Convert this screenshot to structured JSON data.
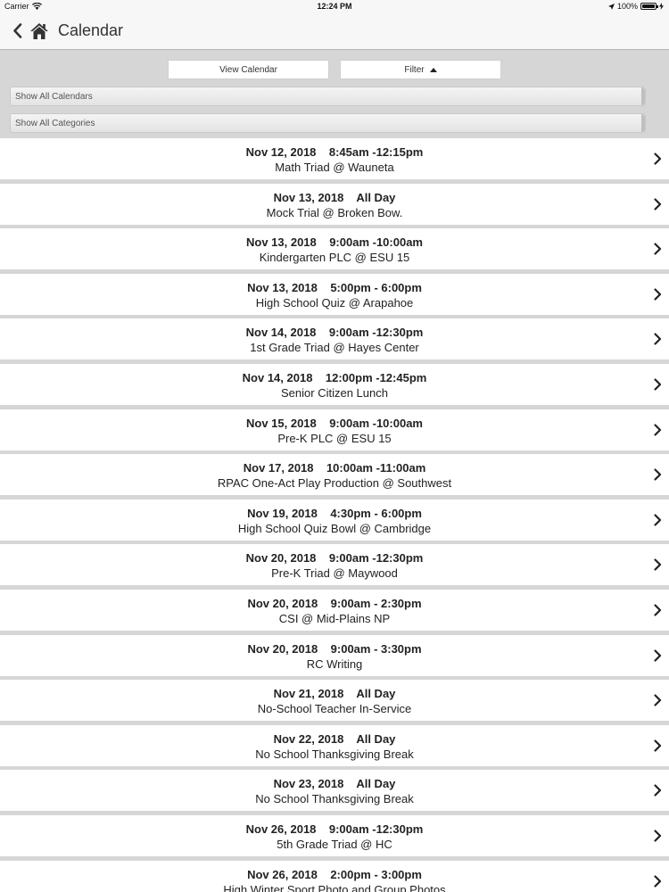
{
  "status_bar": {
    "carrier": "Carrier",
    "time": "12:24 PM",
    "battery": "100%",
    "battery_level": 1.0
  },
  "nav": {
    "title": "Calendar"
  },
  "toolbar": {
    "view_calendar_label": "View Calendar",
    "filter_label": "Filter"
  },
  "dropdowns": {
    "calendars": "Show All Calendars",
    "categories": "Show All Categories"
  },
  "events": [
    {
      "when": "Nov 12, 2018    8:45am -12:15pm",
      "title": "Math Triad @ Wauneta"
    },
    {
      "when": "Nov 13, 2018    All Day",
      "title": "Mock Trial @ Broken Bow."
    },
    {
      "when": "Nov 13, 2018    9:00am -10:00am",
      "title": "Kindergarten PLC @ ESU 15"
    },
    {
      "when": "Nov 13, 2018    5:00pm - 6:00pm",
      "title": "High School Quiz @ Arapahoe"
    },
    {
      "when": "Nov 14, 2018    9:00am -12:30pm",
      "title": "1st Grade Triad @ Hayes Center"
    },
    {
      "when": "Nov 14, 2018    12:00pm -12:45pm",
      "title": "Senior Citizen Lunch"
    },
    {
      "when": "Nov 15, 2018    9:00am -10:00am",
      "title": "Pre-K PLC @ ESU 15"
    },
    {
      "when": "Nov 17, 2018    10:00am -11:00am",
      "title": "RPAC One-Act Play Production @ Southwest"
    },
    {
      "when": "Nov 19, 2018    4:30pm - 6:00pm",
      "title": "High School Quiz Bowl @ Cambridge"
    },
    {
      "when": "Nov 20, 2018    9:00am -12:30pm",
      "title": "Pre-K Triad @ Maywood"
    },
    {
      "when": "Nov 20, 2018    9:00am - 2:30pm",
      "title": "CSI @ Mid-Plains NP"
    },
    {
      "when": "Nov 20, 2018    9:00am - 3:30pm",
      "title": "RC Writing"
    },
    {
      "when": "Nov 21, 2018    All Day",
      "title": "No-School Teacher In-Service"
    },
    {
      "when": "Nov 22, 2018    All Day",
      "title": "No School Thanksgiving Break"
    },
    {
      "when": "Nov 23, 2018    All Day",
      "title": "No School Thanksgiving Break"
    },
    {
      "when": "Nov 26, 2018    9:00am -12:30pm",
      "title": "5th Grade Triad @ HC"
    },
    {
      "when": "Nov 26, 2018    2:00pm - 3:00pm",
      "title": "High Winter Sport Photo and Group Photos"
    }
  ]
}
